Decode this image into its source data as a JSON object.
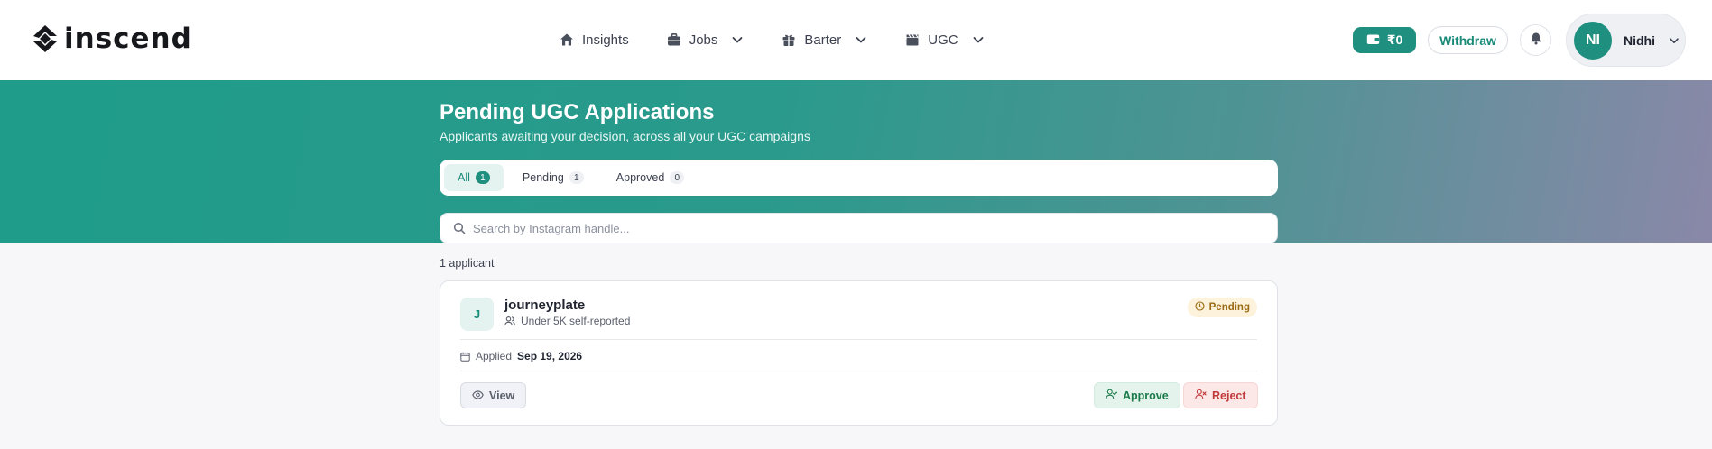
{
  "brand": {
    "name": "inscend"
  },
  "nav": {
    "items": [
      {
        "label": "Insights",
        "icon": "home-icon",
        "dropdown": false
      },
      {
        "label": "Jobs",
        "icon": "briefcase-icon",
        "dropdown": true
      },
      {
        "label": "Barter",
        "icon": "gift-icon",
        "dropdown": true
      },
      {
        "label": "UGC",
        "icon": "clapperboard-icon",
        "dropdown": true
      }
    ]
  },
  "header": {
    "wallet_balance": "₹0",
    "withdraw_label": "Withdraw",
    "user": {
      "initials": "NI",
      "name": "Nidhi"
    }
  },
  "page": {
    "title": "Pending UGC Applications",
    "subtitle": "Applicants awaiting your decision, across all your UGC campaigns"
  },
  "tabs": [
    {
      "label": "All",
      "count": "1",
      "active": true
    },
    {
      "label": "Pending",
      "count": "1",
      "active": false
    },
    {
      "label": "Approved",
      "count": "0",
      "active": false
    }
  ],
  "search": {
    "placeholder": "Search by Instagram handle...",
    "value": ""
  },
  "results": {
    "count_label": "1 applicant"
  },
  "applications": [
    {
      "initial": "J",
      "handle": "journeyplate",
      "followers": "Under 5K self-reported",
      "status": "Pending",
      "applied_label": "Applied",
      "applied_date": "Sep 19, 2026",
      "actions": {
        "view": "View",
        "approve": "Approve",
        "reject": "Reject"
      }
    }
  ],
  "colors": {
    "accent": "#1f8f7f",
    "hero_start": "#1f9c8a",
    "hero_end": "#8a88a8",
    "pending_bg": "#fdf3dc",
    "pending_text": "#9a6a14",
    "approve_text": "#1b7a4a",
    "reject_text": "#c03a3a"
  }
}
